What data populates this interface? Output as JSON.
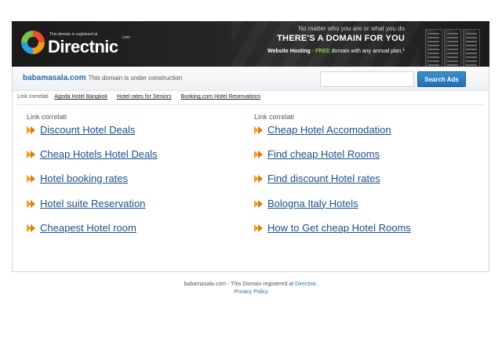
{
  "banner": {
    "logo_small": "This domain is registered at",
    "logo_text": "Directnic",
    "logo_com": ".com",
    "promo_line1": "No matter who you are or what you do",
    "promo_line2": "THERE'S A DOMAIN FOR YOU",
    "promo_hosting": "Website Hosting",
    "promo_dash": " - ",
    "promo_free": "FREE",
    "promo_rest": " domain with any annual plan.*"
  },
  "searchbar": {
    "domain": "babamasala.com",
    "status": "This domain is under construction",
    "input_value": "",
    "button_label": "Search Ads"
  },
  "related": {
    "label": "Link correlati",
    "links": [
      "Agoda Hotel Bangkok",
      "Hotel rates for Seniors",
      "Booking.com Hotel Reservations"
    ]
  },
  "left_column": {
    "title": "Link correlati",
    "links": [
      "Discount Hotel Deals",
      "Cheap Hotels Hotel Deals",
      "Hotel booking rates",
      "Hotel suite Reservation",
      "Cheapest Hotel room"
    ]
  },
  "right_column": {
    "title": "Link correlati",
    "links": [
      "Cheap Hotel Accomodation",
      "Find cheap Hotel Rooms",
      "Find discount Hotel rates",
      "Bologna Italy Hotels",
      "How to Get cheap Hotel Rooms"
    ]
  },
  "footer": {
    "text": "babamasala.com - This Domain registered at ",
    "registrar_link": "Directnic",
    "period": ".",
    "privacy_link": "Privacy Policy"
  },
  "colors": {
    "link": "#1a4f8a",
    "accent": "#2a6fa8",
    "button": "#1f6fb2",
    "arrow": "#f0a02a",
    "free": "#8cc63f"
  }
}
